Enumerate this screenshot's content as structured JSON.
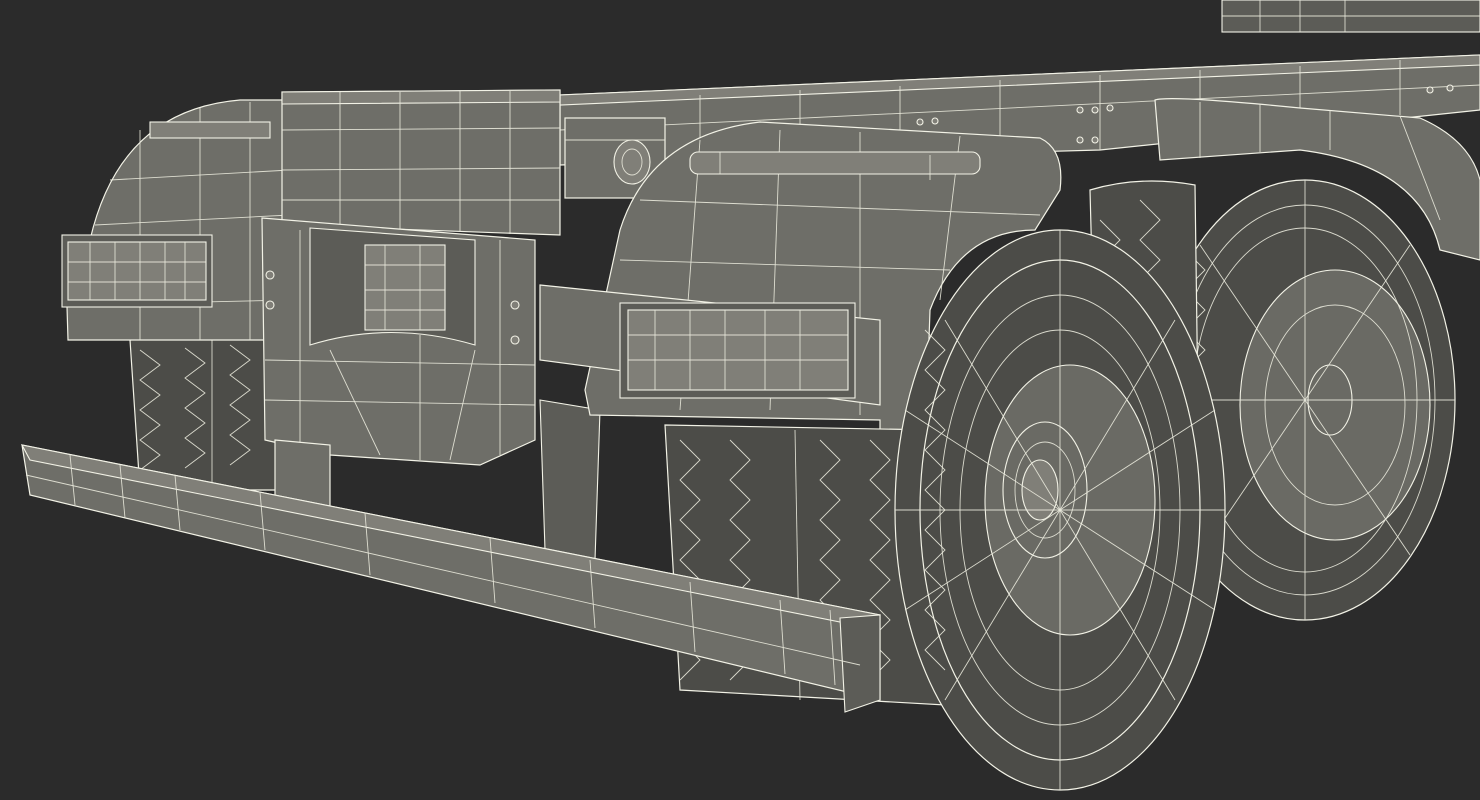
{
  "scene": {
    "subject": "wireframe-3d-truck-chassis-rear",
    "colors": {
      "background": "#2b2b2b",
      "mesh_fill": "#6e6e68",
      "wire": "#f2f2e6",
      "tire": "#4c4c48"
    }
  }
}
